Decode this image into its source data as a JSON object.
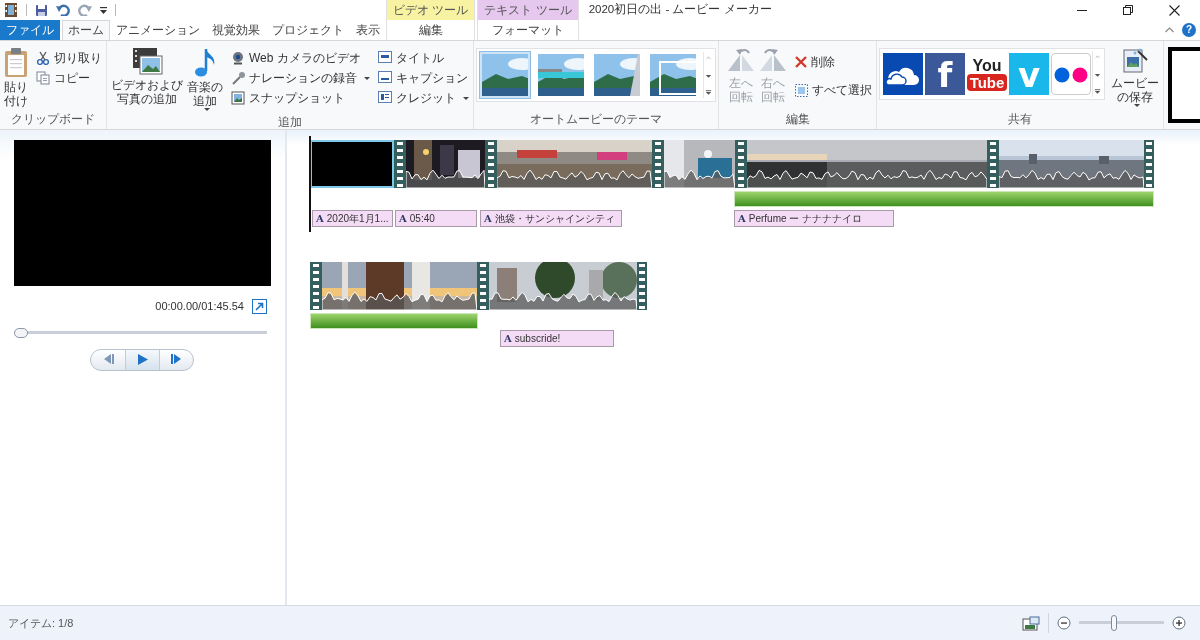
{
  "title_bar": {
    "title": "2020初日の出 - ムービー メーカー",
    "help_glyph": "?"
  },
  "tabs": [
    {
      "label": "ファイル",
      "kind": "file",
      "selected": false
    },
    {
      "label": "ホーム",
      "kind": "tab",
      "selected": true
    },
    {
      "label": "アニメーション",
      "kind": "tab",
      "selected": false
    },
    {
      "label": "視覚効果",
      "kind": "tab",
      "selected": false
    },
    {
      "label": "プロジェクト",
      "kind": "tab",
      "selected": false
    },
    {
      "label": "表示",
      "kind": "tab",
      "selected": false
    }
  ],
  "context_groups": [
    {
      "label": "ビデオ ツール",
      "color": "#f7f3a2",
      "tabs": [
        {
          "label": "編集",
          "selected": false
        }
      ]
    },
    {
      "label": "テキスト ツール",
      "color": "#e6c8ef",
      "tabs": [
        {
          "label": "フォーマット",
          "selected": false
        }
      ]
    }
  ],
  "ribbon": [
    {
      "kind": "clipboard",
      "label": "クリップボード",
      "big": [
        {
          "lines": [
            "貼り",
            "付け"
          ],
          "dropdown": false,
          "disabled": false
        }
      ],
      "small": [
        {
          "label": "切り取り",
          "dropdown": false,
          "disabled": false
        },
        {
          "label": "コピー",
          "dropdown": false,
          "disabled": false
        }
      ]
    },
    {
      "kind": "add",
      "label": "追加",
      "big": [
        {
          "lines": [
            "ビデオおよび",
            "写真の追加"
          ],
          "dropdown": false,
          "disabled": false
        },
        {
          "lines": [
            "音楽の",
            "追加"
          ],
          "dropdown": true,
          "disabled": false
        }
      ],
      "columns": [
        [
          {
            "label": "Web カメラのビデオ",
            "dropdown": false,
            "disabled": false
          },
          {
            "label": "ナレーションの録音",
            "dropdown": true,
            "disabled": false
          },
          {
            "label": "スナップショット",
            "dropdown": false,
            "disabled": false
          }
        ],
        [
          {
            "label": "タイトル",
            "dropdown": false,
            "disabled": false
          },
          {
            "label": "キャプション",
            "dropdown": false,
            "disabled": false
          },
          {
            "label": "クレジット",
            "dropdown": true,
            "disabled": false
          }
        ]
      ]
    },
    {
      "kind": "themes",
      "label": "オートムービーのテーマ",
      "items": [
        {
          "selected": true
        },
        {
          "selected": false
        },
        {
          "selected": false
        },
        {
          "selected": false
        }
      ]
    },
    {
      "kind": "edit",
      "label": "編集",
      "big": [
        {
          "lines": [
            "左へ",
            "回転"
          ],
          "dropdown": false,
          "disabled": true
        },
        {
          "lines": [
            "右へ",
            "回転"
          ],
          "dropdown": false,
          "disabled": true
        }
      ],
      "small": [
        {
          "label": "削除",
          "dropdown": false,
          "disabled": false
        },
        {
          "label": "すべて選択",
          "dropdown": false,
          "disabled": false
        }
      ]
    },
    {
      "kind": "share",
      "label": "共有",
      "items": [
        {
          "kind": "cloud"
        },
        {
          "kind": "letter",
          "glyph": "f",
          "color": "#3b5998"
        },
        {
          "kind": "stacked",
          "lines": [
            "You",
            "Tube"
          ]
        },
        {
          "kind": "letter",
          "glyph": "v",
          "color": "#1ab7ea"
        },
        {
          "kind": "dots"
        }
      ],
      "save": {
        "lines": [
          "ムービー",
          "の保存"
        ],
        "dropdown": true,
        "disabled": false
      }
    }
  ],
  "preview": {
    "time": "00:00.00/01:45.54",
    "seek": {
      "level": 0
    }
  },
  "timeline": [
    {
      "clips": [
        {
          "kind": "black",
          "selected": true
        },
        {
          "kind": "video",
          "selected": false
        },
        {
          "kind": "video",
          "selected": false
        },
        {
          "kind": "video",
          "selected": false
        },
        {
          "kind": "video",
          "selected": false
        },
        {
          "kind": "video",
          "selected": false
        }
      ],
      "music": [
        {
          "kind": "audio"
        }
      ],
      "captions": [
        {
          "glyph": "A",
          "text": "2020年1月1..."
        },
        {
          "glyph": "A",
          "text": "05:40"
        },
        {
          "glyph": "A",
          "text": "池袋・サンシャインシティ"
        },
        {
          "glyph": "A",
          "text": "Perfume ー ナナナナイロ"
        }
      ]
    },
    {
      "clips": [
        {
          "kind": "video",
          "selected": false
        },
        {
          "kind": "video",
          "selected": false
        }
      ],
      "music": [
        {
          "kind": "audio"
        }
      ],
      "captions": [
        {
          "glyph": "A",
          "text": "subscride!"
        }
      ]
    }
  ],
  "status_bar": {
    "items": "アイテム: 1/8",
    "zoom": {
      "level": 0.41
    }
  }
}
